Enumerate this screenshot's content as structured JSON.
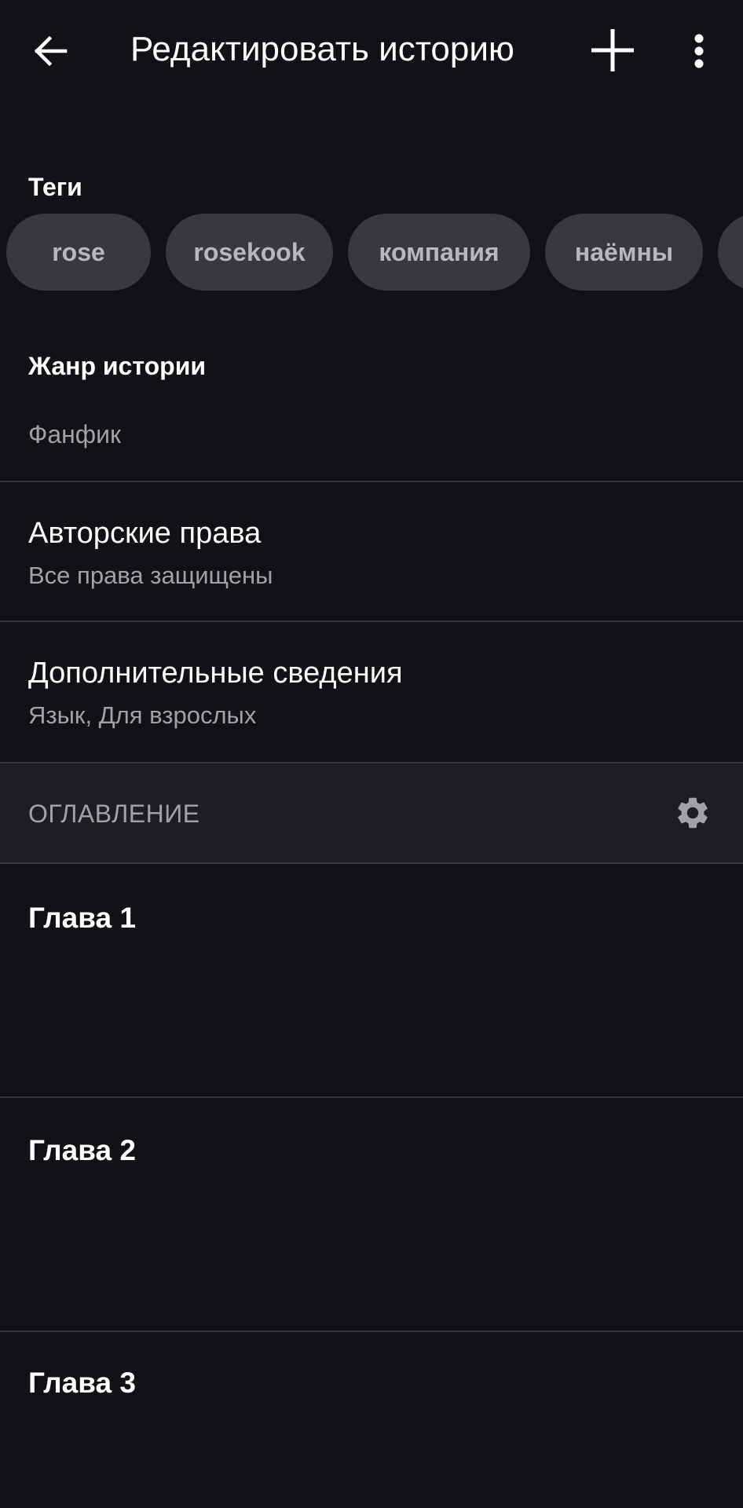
{
  "app_bar": {
    "title": "Редактировать историю",
    "back_icon": "arrow-left-icon",
    "add_icon": "plus-icon",
    "more_icon": "more-vertical-icon"
  },
  "tags": {
    "label": "Теги",
    "items": [
      "rose",
      "rosekook",
      "компания",
      "наёмны"
    ]
  },
  "genre": {
    "label": "Жанр истории",
    "value": "Фанфик"
  },
  "copyright": {
    "title": "Авторские права",
    "subtitle": "Все права защищены"
  },
  "details": {
    "title": "Дополнительные сведения",
    "subtitle": "Язык, Для взрослых"
  },
  "toc": {
    "label": "ОГЛАВЛЕНИЕ",
    "settings_icon": "gear-icon",
    "chapters": [
      "Глава 1",
      "Глава 2",
      "Глава 3"
    ]
  },
  "colors": {
    "background": "#131115",
    "chip": "#3a383c",
    "section_bg": "#1f1d21",
    "divider": "#38363b",
    "secondary_text": "#a3a1a7"
  }
}
